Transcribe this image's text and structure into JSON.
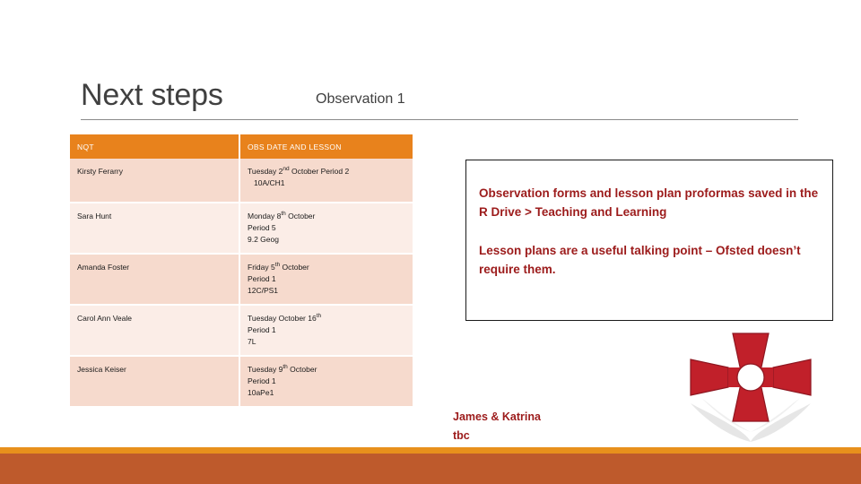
{
  "slide": {
    "title": "Next steps",
    "subtitle": "Observation 1"
  },
  "table": {
    "headers": {
      "name": "NQT",
      "obs": "OBS DATE AND LESSON"
    },
    "rows": [
      {
        "name": "Kirsty Ferarry",
        "obs_line_1": "Tuesday 2",
        "obs_sup_1": "nd",
        "obs_line_1_rest": " October Period 2",
        "obs_line_2": "10A/CH1",
        "obs_line_3": ""
      },
      {
        "name": "Sara Hunt",
        "obs_line_1": "Monday 8",
        "obs_sup_1": "th",
        "obs_line_1_rest": " October",
        "obs_line_2": "Period 5",
        "obs_line_3": "9.2 Geog"
      },
      {
        "name": "Amanda Foster",
        "obs_line_1": "Friday 5",
        "obs_sup_1": "th",
        "obs_line_1_rest": " October",
        "obs_line_2": "Period 1",
        "obs_line_3": "12C/PS1"
      },
      {
        "name": "Carol Ann Veale",
        "obs_line_1": "Tuesday October 16",
        "obs_sup_1": "th",
        "obs_line_1_rest": "",
        "obs_line_2": "Period 1",
        "obs_line_3": "7L"
      },
      {
        "name": "Jessica Keiser",
        "obs_line_1": "Tuesday 9",
        "obs_sup_1": "th",
        "obs_line_1_rest": " October",
        "obs_line_2": "Period 1",
        "obs_line_3": "10aPe1"
      }
    ]
  },
  "callout": {
    "paragraph_1": "Observation forms and lesson plan proformas saved in the R Drive > Teaching and Learning",
    "paragraph_2": "Lesson plans are a useful talking point – Ofsted doesn’t require them."
  },
  "signature": {
    "line_1": "James & Katrina",
    "line_2": "tbc"
  },
  "logo": {
    "name": "school-cross-logo"
  },
  "colors": {
    "header_orange": "#E8821C",
    "row_dark": "#F6DACD",
    "row_light": "#FBEDE7",
    "accent_red": "#9C1B1B",
    "logo_red": "#C1202A",
    "bar_thin_orange": "#E8901C",
    "bar_thick_brown": "#BE5A2C",
    "title_gray": "#404040"
  }
}
